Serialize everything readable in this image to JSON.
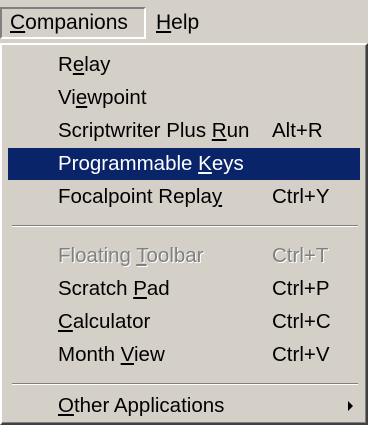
{
  "menubar": {
    "items": [
      {
        "pre": "",
        "key": "C",
        "post": "ompanions"
      },
      {
        "pre": "",
        "key": "H",
        "post": "elp"
      }
    ]
  },
  "menu": {
    "items": [
      {
        "pre": "R",
        "key": "e",
        "post": "lay",
        "shortcut": ""
      },
      {
        "pre": "Vi",
        "key": "e",
        "post": "wpoint",
        "shortcut": ""
      },
      {
        "pre": "Scriptwriter Plus ",
        "key": "R",
        "post": "un",
        "shortcut": "Alt+R"
      },
      {
        "pre": "Programmable ",
        "key": "K",
        "post": "eys",
        "shortcut": ""
      },
      {
        "pre": "Focalpoint Repla",
        "key": "y",
        "post": "",
        "shortcut": "Ctrl+Y"
      },
      {
        "pre": "Floating ",
        "key": "T",
        "post": "oolbar",
        "shortcut": "Ctrl+T"
      },
      {
        "pre": "Scratch ",
        "key": "P",
        "post": "ad",
        "shortcut": "Ctrl+P"
      },
      {
        "pre": "",
        "key": "C",
        "post": "alculator",
        "shortcut": "Ctrl+C"
      },
      {
        "pre": "Month ",
        "key": "V",
        "post": "iew",
        "shortcut": "Ctrl+V"
      },
      {
        "pre": "",
        "key": "O",
        "post": "ther Applications",
        "shortcut": ""
      }
    ]
  },
  "icons": {
    "submenu": "chevron-right-icon"
  }
}
